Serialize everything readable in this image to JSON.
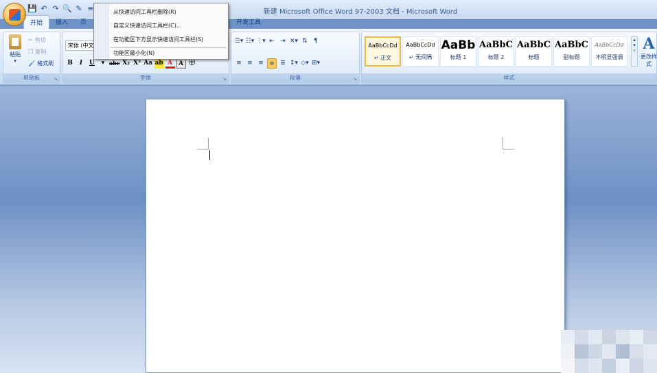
{
  "window": {
    "title": "新建 Microsoft Office Word 97-2003 文档 - Microsoft Word"
  },
  "quick_access": {
    "icons": [
      "save-icon",
      "undo-icon",
      "redo-icon",
      "print-preview-icon",
      "edit-icon",
      "format-icon"
    ]
  },
  "tabs": [
    {
      "label": "开始",
      "active": true
    },
    {
      "label": "插入",
      "active": false
    },
    {
      "label": "页",
      "active": false
    },
    {
      "label": "开发工具",
      "active": false
    }
  ],
  "clipboard": {
    "paste_label": "粘贴",
    "cut_label": "剪切",
    "copy_label": "复制",
    "format_painter_label": "格式刷",
    "group_label": "剪贴板"
  },
  "font": {
    "font_name": "宋体 (中文",
    "bold": "B",
    "italic": "I",
    "underline": "U",
    "strikethrough": "abc",
    "subscript": "X₂",
    "superscript": "X²",
    "change_case": "Aa",
    "char_border": "A",
    "enclose_char": "㊉",
    "group_label": "字体"
  },
  "paragraph": {
    "group_label": "段落"
  },
  "styles": {
    "group_label": "样式",
    "change_styles_label": "更改样式",
    "items": [
      {
        "sample": "AaBbCcDd",
        "name": "↵ 正文",
        "selected": true
      },
      {
        "sample": "AaBbCcDd",
        "name": "↵ 无间隔",
        "selected": false
      },
      {
        "sample": "AaBb",
        "name": "标题 1",
        "selected": false
      },
      {
        "sample": "AaBbC",
        "name": "标题 2",
        "selected": false
      },
      {
        "sample": "AaBbC",
        "name": "标题",
        "selected": false
      },
      {
        "sample": "AaBbC",
        "name": "副标题",
        "selected": false
      },
      {
        "sample": "AaBbCcDd",
        "name": "不明显强调",
        "selected": false
      }
    ]
  },
  "context_menu": {
    "items": [
      {
        "label": "从快速访问工具栏删除(R)"
      },
      {
        "label": "自定义快速访问工具栏(C)..."
      },
      {
        "label": "在功能区下方显示快速访问工具栏(S)"
      },
      {
        "label": "功能区最小化(N)"
      }
    ]
  },
  "colors": {
    "title_bg": "#dbe7f7",
    "ribbon_bg": "#d7e5f7",
    "doc_bg": "#6f93c6",
    "selected_style": "#f2b842"
  }
}
